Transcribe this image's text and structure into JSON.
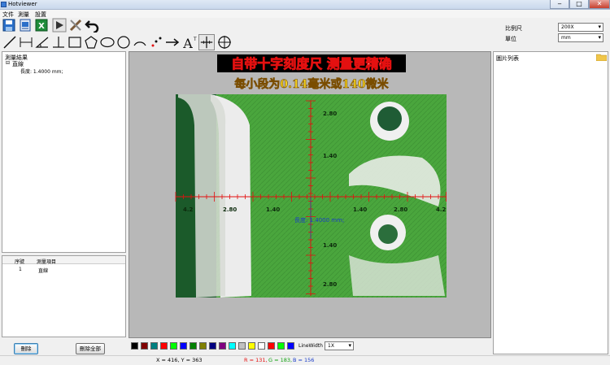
{
  "window": {
    "title": "Hotviewer"
  },
  "menu": [
    "文件",
    "測量",
    "設置"
  ],
  "settings": {
    "scale_label": "比例尺",
    "scale_value": "200X",
    "unit_label": "單位",
    "unit_value": "mm"
  },
  "result_tree": {
    "header": "測量結果",
    "node": "直線",
    "leaf": "長度: 1.4000 mm;"
  },
  "result_table": {
    "headers": [
      "序號",
      "測量項目"
    ],
    "rows": [
      {
        "index": "1",
        "item": "直線"
      }
    ]
  },
  "buttons": {
    "delete": "刪除",
    "delete_all": "刪除全部"
  },
  "line_width": {
    "label": "LineWidth",
    "value": "1X"
  },
  "palette": [
    "#000000",
    "#800000",
    "#008080",
    "#ff0000",
    "#00ff00",
    "#0000ff",
    "#008000",
    "#808000",
    "#000080",
    "#800080",
    "#00ffff",
    "#c0c0c0",
    "#ffff00",
    "#ffffff",
    "#ff0000",
    "#00ff00",
    "#0000ff"
  ],
  "picture_list": {
    "header": "圖片列表"
  },
  "status": {
    "coords": "X = 416, Y = 363",
    "r": "R = 131,",
    "g": "G = 183,",
    "b": "B = 156"
  },
  "canvas": {
    "banner1": "自带十字刻度尺 测量更精确",
    "banner2": "每小段为0.14毫米或140微米",
    "measure_label": "長度: 1.4000 mm;",
    "ticks_top": [
      "2.80",
      "1.40"
    ],
    "ticks_bottom": [
      "1.40",
      "2.80"
    ],
    "ticks_left": [
      "2.80",
      "1.40"
    ],
    "ticks_right": [
      "1.40",
      "2.80",
      "4.2"
    ]
  },
  "colors": {
    "accent_red": "#e41010",
    "measure_blue": "#1a3cc8",
    "pcb_green": "#4aa63d"
  }
}
